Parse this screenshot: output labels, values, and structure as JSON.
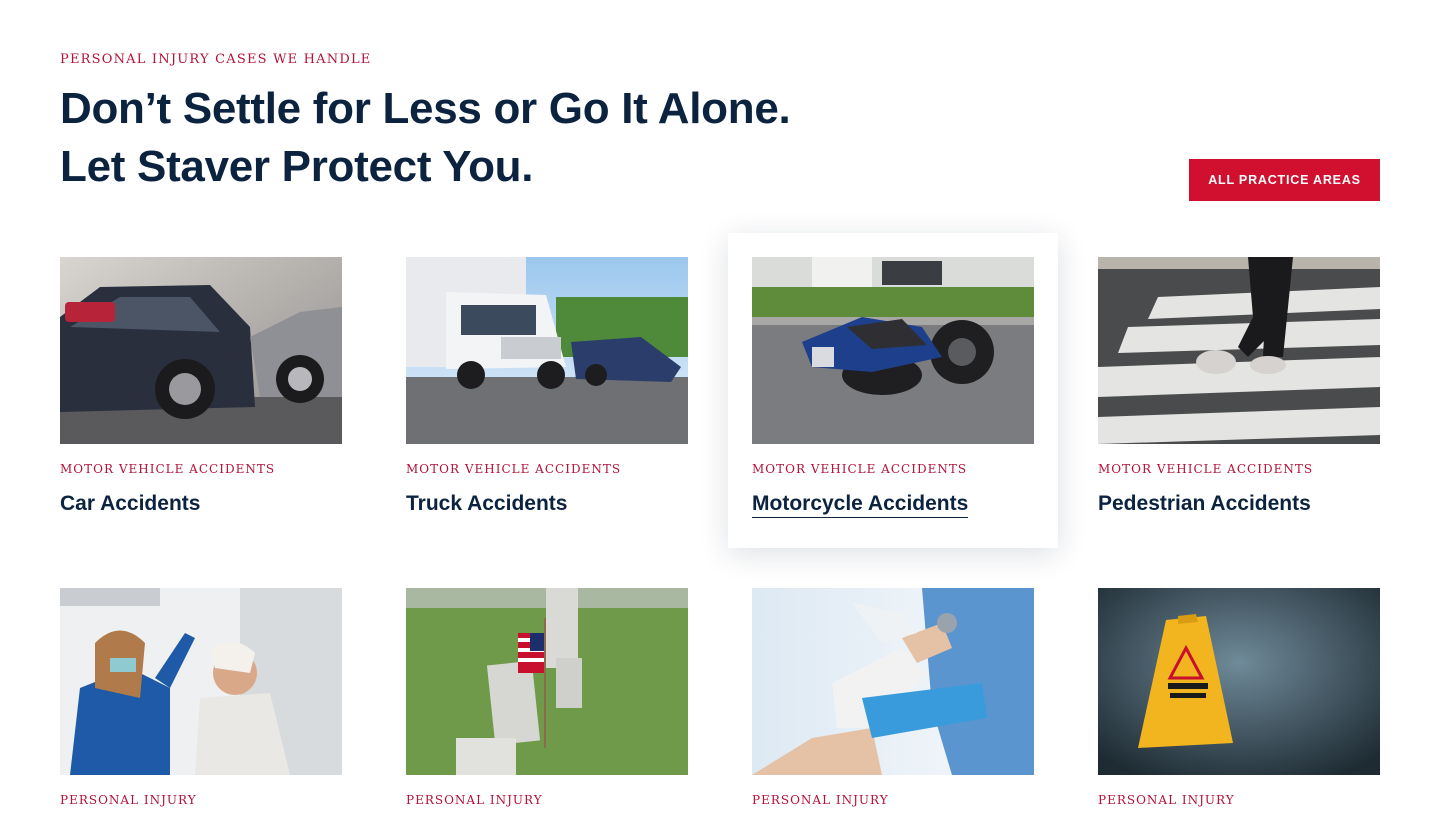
{
  "section": {
    "eyebrow": "PERSONAL INJURY CASES WE HANDLE",
    "headline_line1": "Don’t Settle for Less or Go It Alone.",
    "headline_line2": "Let Staver Protect You.",
    "cta_label": "ALL PRACTICE AREAS"
  },
  "colors": {
    "accent_red": "#d1102f",
    "eyebrow_red": "#b3123a",
    "navy": "#0c2340"
  },
  "cards": [
    {
      "category": "MOTOR VEHICLE ACCIDENTS",
      "title": "Car Accidents",
      "image": "car-crash-photo"
    },
    {
      "category": "MOTOR VEHICLE ACCIDENTS",
      "title": "Truck Accidents",
      "image": "truck-crash-photo"
    },
    {
      "category": "MOTOR VEHICLE ACCIDENTS",
      "title": "Motorcycle Accidents",
      "image": "motorcycle-crash-photo"
    },
    {
      "category": "MOTOR VEHICLE ACCIDENTS",
      "title": "Pedestrian Accidents",
      "image": "crosswalk-photo"
    },
    {
      "category": "PERSONAL INJURY",
      "title": "",
      "image": "head-injury-photo"
    },
    {
      "category": "PERSONAL INJURY",
      "title": "",
      "image": "cemetery-flag-photo"
    },
    {
      "category": "PERSONAL INJURY",
      "title": "",
      "image": "bandaged-hand-photo"
    },
    {
      "category": "PERSONAL INJURY",
      "title": "",
      "image": "wet-floor-sign-photo"
    }
  ]
}
